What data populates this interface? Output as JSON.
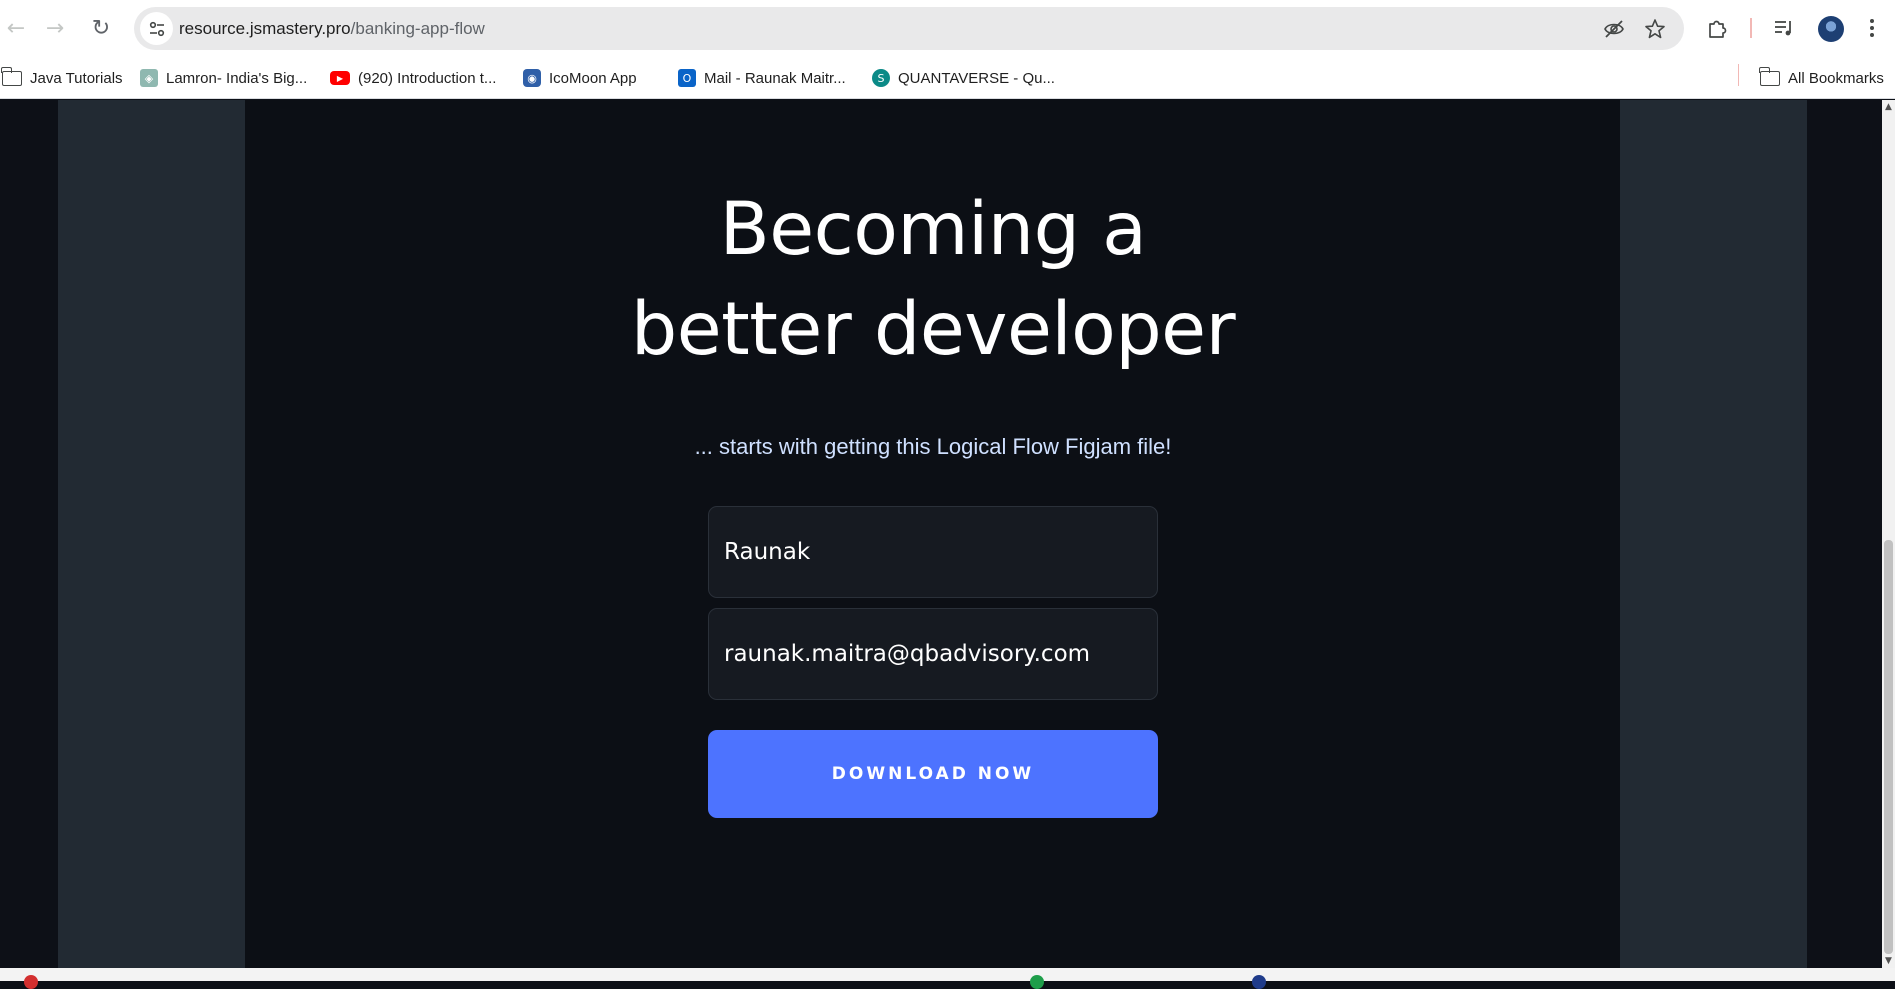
{
  "browser": {
    "url_domain": "resource.jsmastery.pro",
    "url_path": "/banking-app-flow",
    "nav": {
      "back": "←",
      "forward": "→",
      "reload": "↻"
    },
    "icons": [
      "site-info-icon",
      "eye-off-icon",
      "star-icon",
      "extensions-icon",
      "media-icon",
      "profile-avatar",
      "menu-icon"
    ]
  },
  "bookmarks": {
    "items": [
      {
        "label": "Java Tutorials",
        "icon": "folder-icon"
      },
      {
        "label": "Lamron- India's Big...",
        "icon": "lamron-icon"
      },
      {
        "label": "(920) Introduction t...",
        "icon": "youtube-icon"
      },
      {
        "label": "IcoMoon App",
        "icon": "icomoon-icon"
      },
      {
        "label": "Mail - Raunak Maitr...",
        "icon": "outlook-icon"
      },
      {
        "label": "QUANTAVERSE - Qu...",
        "icon": "sharepoint-icon"
      }
    ],
    "all_bookmarks": "All Bookmarks"
  },
  "hero": {
    "headline_line1": "Becoming a",
    "headline_line2": "better developer",
    "subtitle": "... starts with getting this Logical Flow Figjam file!"
  },
  "form": {
    "name_value": "Raunak",
    "email_value": "raunak.maitra@qbadvisory.com",
    "submit_label": "DOWNLOAD NOW"
  },
  "colors": {
    "page_bg": "#0d1017",
    "side_column": "#222a33",
    "center_panel": "#0c0f15",
    "input_bg": "#161a21",
    "cta_blue": "#4d73ff",
    "subtitle_text": "#cfe0ff"
  }
}
